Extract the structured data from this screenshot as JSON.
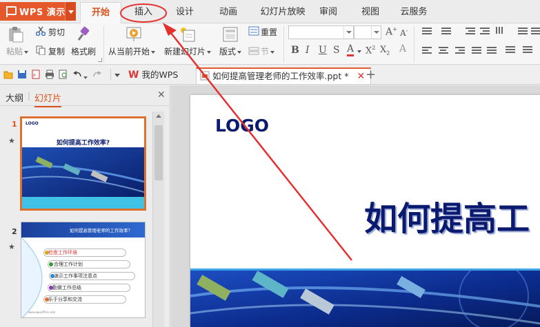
{
  "app": {
    "name": "WPS 演示",
    "accent": "#e5582a"
  },
  "tabs": [
    {
      "label": "开始",
      "active": true
    },
    {
      "label": "插入",
      "active": false,
      "highlighted": true
    },
    {
      "label": "设计",
      "active": false
    },
    {
      "label": "动画",
      "active": false
    },
    {
      "label": "幻灯片放映",
      "active": false
    },
    {
      "label": "审阅",
      "active": false
    },
    {
      "label": "视图",
      "active": false
    },
    {
      "label": "云服务",
      "active": false
    }
  ],
  "ribbon": {
    "paste": "粘贴",
    "cut": "剪切",
    "copy": "复制",
    "format_painter": "格式刷",
    "from_current": "从当前开始",
    "new_slide": "新建幻灯片",
    "layout": "版式",
    "reset": "重置",
    "section": "节",
    "font_name": "",
    "font_size": ""
  },
  "quickbar": {
    "my_wps": "我的WPS",
    "document_tab": "如何提高管理老师的工作效率.ppt *",
    "modified": true
  },
  "left_pane": {
    "outline_tab": "大纲",
    "slides_tab": "幻灯片",
    "slides": [
      {
        "number": "1",
        "logo": "LOGO",
        "title": "如何提高工作效率?",
        "selected": true
      },
      {
        "number": "2",
        "header": "如何提高管理老师的工作效率？",
        "items": [
          "检查工作环境",
          "合理工作计划",
          "演示工作事项注意点",
          "勤做工作总结",
          "乐于分享和交流"
        ],
        "footer": "www.wpsoffice.com"
      }
    ]
  },
  "slide": {
    "logo": "LOGO",
    "title": "如何提高工"
  },
  "colors": {
    "tab_active": "#d9531e",
    "annotation": "#e63030",
    "slide_title": "#0a1a6e"
  }
}
